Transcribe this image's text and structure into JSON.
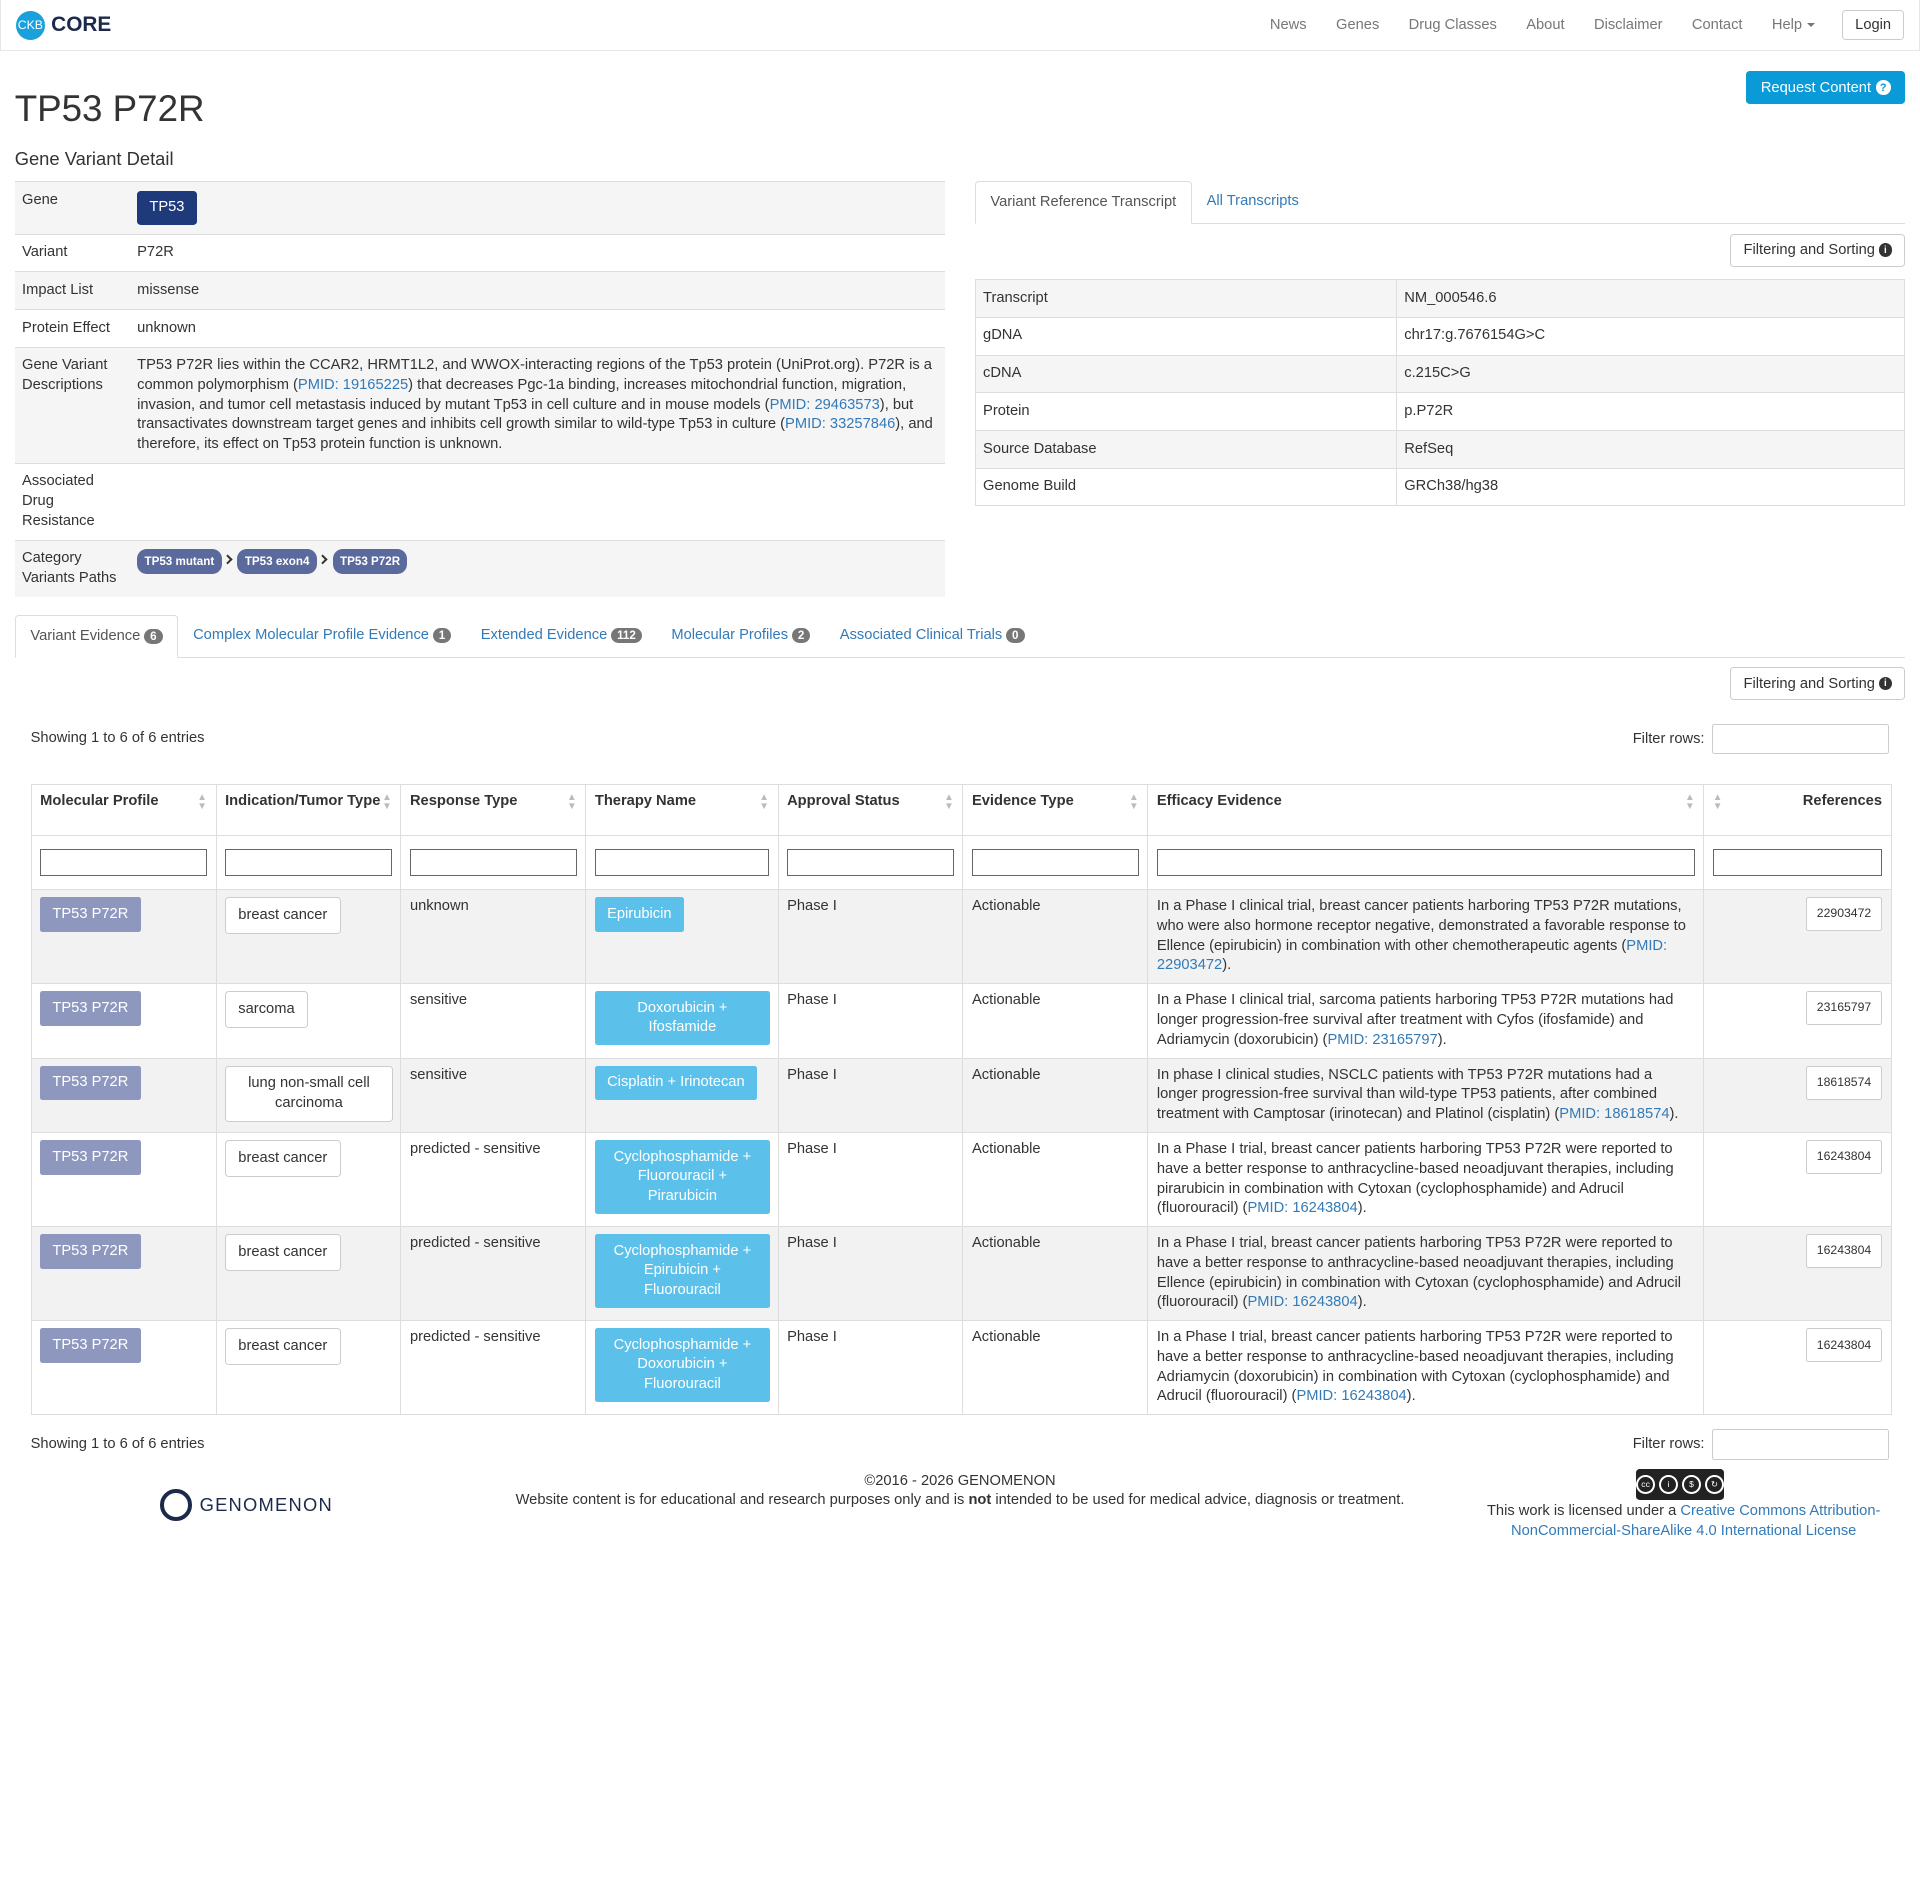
{
  "brand": {
    "logo": "CKB",
    "name": "CORE"
  },
  "nav": {
    "items": [
      "News",
      "Genes",
      "Drug Classes",
      "About",
      "Disclaimer",
      "Contact"
    ],
    "help": "Help",
    "login": "Login"
  },
  "header": {
    "title": "TP53 P72R",
    "subtitle": "Gene Variant Detail",
    "request_btn": "Request Content"
  },
  "detail": {
    "gene_label": "Gene",
    "gene": "TP53",
    "variant_label": "Variant",
    "variant": "P72R",
    "impact_label": "Impact List",
    "impact": "missense",
    "protein_effect_label": "Protein Effect",
    "protein_effect": "unknown",
    "desc_label": "Gene Variant Descriptions",
    "desc_parts": [
      "TP53 P72R lies within the CCAR2, HRMT1L2, and WWOX-interacting regions of the Tp53 protein (UniProt.org). P72R is a common polymorphism (",
      "PMID: 19165225",
      ") that decreases Pgc-1a binding, increases mitochondrial function, migration, invasion, and tumor cell metastasis induced by mutant Tp53 in cell culture and in mouse models (",
      "PMID: 29463573",
      "), but transactivates downstream target genes and inhibits cell growth similar to wild-type Tp53 in culture (",
      "PMID: 33257846",
      "), and therefore, its effect on Tp53 protein function is unknown."
    ],
    "drug_resistance_label": "Associated Drug Resistance",
    "category_label": "Category Variants Paths",
    "category_paths": [
      "TP53 mutant",
      "TP53 exon4",
      "TP53 P72R"
    ]
  },
  "right_tabs": [
    "Variant Reference Transcript",
    "All Transcripts"
  ],
  "filter_sorting": "Filtering and Sorting",
  "transcript": [
    [
      "Transcript",
      "NM_000546.6"
    ],
    [
      "gDNA",
      "chr17:g.7676154G>C"
    ],
    [
      "cDNA",
      "c.215C>G"
    ],
    [
      "Protein",
      "p.P72R"
    ],
    [
      "Source Database",
      "RefSeq"
    ],
    [
      "Genome Build",
      "GRCh38/hg38"
    ]
  ],
  "evidence_tabs": [
    {
      "label": "Variant Evidence",
      "count": "6"
    },
    {
      "label": "Complex Molecular Profile Evidence",
      "count": "1"
    },
    {
      "label": "Extended Evidence",
      "count": "112"
    },
    {
      "label": "Molecular Profiles",
      "count": "2"
    },
    {
      "label": "Associated Clinical Trials",
      "count": "0"
    }
  ],
  "showing": "Showing 1 to 6 of 6 entries",
  "filter_rows_label": "Filter rows:",
  "columns": [
    "Molecular Profile",
    "Indication/Tumor Type",
    "Response Type",
    "Therapy Name",
    "Approval Status",
    "Evidence Type",
    "Efficacy Evidence",
    "References"
  ],
  "rows": [
    {
      "profile": "TP53 P72R",
      "indication": "breast cancer",
      "response": "unknown",
      "therapy": "Epirubicin",
      "approval": "Phase I",
      "evidence_type": "Actionable",
      "efficacy": "In a Phase I clinical trial, breast cancer patients harboring TP53 P72R mutations, who were also hormone receptor negative, demonstrated a favorable response to Ellence (epirubicin) in combination with other chemotherapeutic agents (",
      "pmid": "PMID: 22903472",
      "tail": ").",
      "ref": "22903472"
    },
    {
      "profile": "TP53 P72R",
      "indication": "sarcoma",
      "response": "sensitive",
      "therapy": "Doxorubicin + Ifosfamide",
      "approval": "Phase I",
      "evidence_type": "Actionable",
      "efficacy": "In a Phase I clinical trial, sarcoma patients harboring TP53 P72R mutations had longer progression-free survival after treatment with Cyfos (ifosfamide) and Adriamycin (doxorubicin) (",
      "pmid": "PMID: 23165797",
      "tail": ").",
      "ref": "23165797"
    },
    {
      "profile": "TP53 P72R",
      "indication": "lung non-small cell carcinoma",
      "response": "sensitive",
      "therapy": "Cisplatin + Irinotecan",
      "approval": "Phase I",
      "evidence_type": "Actionable",
      "efficacy": "In phase I clinical studies, NSCLC patients with TP53 P72R mutations had a longer progression-free survival than wild-type TP53 patients, after combined treatment with Camptosar (irinotecan) and Platinol (cisplatin) (",
      "pmid": "PMID: 18618574",
      "tail": ").",
      "ref": "18618574"
    },
    {
      "profile": "TP53 P72R",
      "indication": "breast cancer",
      "response": "predicted - sensitive",
      "therapy": "Cyclophosphamide + Fluorouracil + Pirarubicin",
      "approval": "Phase I",
      "evidence_type": "Actionable",
      "efficacy": "In a Phase I trial, breast cancer patients harboring TP53 P72R were reported to have a better response to anthracycline-based neoadjuvant therapies, including pirarubicin in combination with Cytoxan (cyclophosphamide) and Adrucil (fluorouracil) (",
      "pmid": "PMID: 16243804",
      "tail": ").",
      "ref": "16243804"
    },
    {
      "profile": "TP53 P72R",
      "indication": "breast cancer",
      "response": "predicted - sensitive",
      "therapy": "Cyclophosphamide + Epirubicin + Fluorouracil",
      "approval": "Phase I",
      "evidence_type": "Actionable",
      "efficacy": "In a Phase I trial, breast cancer patients harboring TP53 P72R were reported to have a better response to anthracycline-based neoadjuvant therapies, including Ellence (epirubicin) in combination with Cytoxan (cyclophosphamide) and Adrucil (fluorouracil) (",
      "pmid": "PMID: 16243804",
      "tail": ").",
      "ref": "16243804"
    },
    {
      "profile": "TP53 P72R",
      "indication": "breast cancer",
      "response": "predicted - sensitive",
      "therapy": "Cyclophosphamide + Doxorubicin + Fluorouracil",
      "approval": "Phase I",
      "evidence_type": "Actionable",
      "efficacy": "In a Phase I trial, breast cancer patients harboring TP53 P72R were reported to have a better response to anthracycline-based neoadjuvant therapies, including Adriamycin (doxorubicin) in combination with Cytoxan (cyclophosphamide) and Adrucil (fluorouracil) (",
      "pmid": "PMID: 16243804",
      "tail": ").",
      "ref": "16243804"
    }
  ],
  "footer": {
    "company": "GENOMENON",
    "copyright": "©2016 - 2026 GENOMENON",
    "disclaimer_pre": "Website content is for educational and research purposes only and is ",
    "disclaimer_not": "not",
    "disclaimer_post": " intended to be used for medical advice, diagnosis or treatment.",
    "license_pre": "This work is licensed under a ",
    "license_link": "Creative Commons Attribution-NonCommercial-ShareAlike 4.0 International License",
    "license_badge": "BY NC SA"
  }
}
